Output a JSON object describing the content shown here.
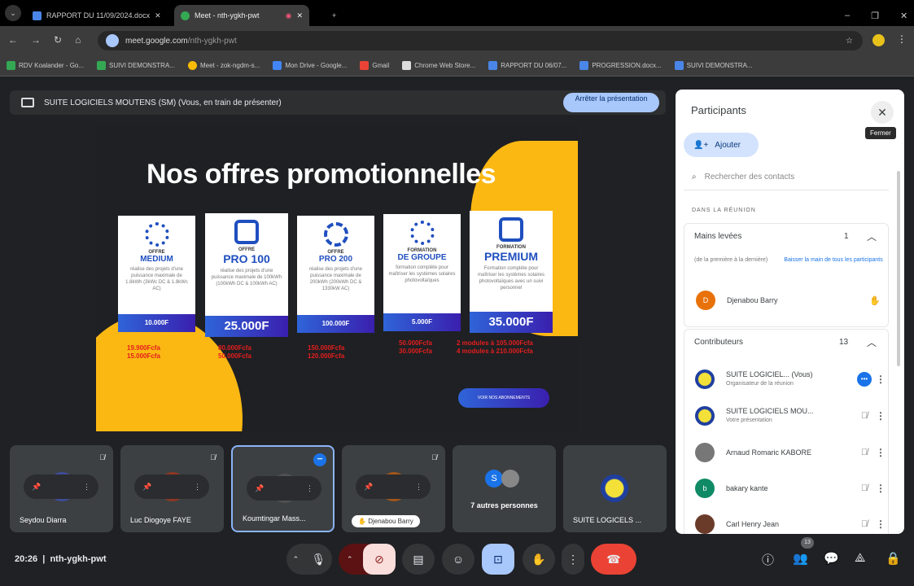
{
  "browser": {
    "tabs": [
      {
        "title": "RAPPORT DU 11/09/2024.docx"
      },
      {
        "title": "Meet - nth-ygkh-pwt"
      }
    ],
    "url_host": "meet.google.com",
    "url_path": "/nth-ygkh-pwt",
    "bookmarks": [
      "RDV Koalander - Go...",
      "SUIVI DEMONSTRA...",
      "Meet - zok-ngdm-s...",
      "Mon Drive - Google...",
      "Gmail",
      "Chrome Web Store...",
      "RAPPORT DU 06/07...",
      "PROGRESSION.docx...",
      "SUIVI DEMONSTRA..."
    ]
  },
  "banner": {
    "text": "SUITE LOGICIELS MOUTENS (SM) (Vous, en train de présenter)",
    "stop_label": "Arrêter la présentation"
  },
  "slide": {
    "title": "Nos offres promotionnelles",
    "cards": [
      {
        "kind": "OFFRE",
        "name": "MEDIUM",
        "desc": "réalise des projets d'une puissance maximale de 1.8kWh (3kWc DC & 1.8kWc AC)",
        "price": "10.000F",
        "old": [
          "19.900Fcfa",
          "15.000Fcfa"
        ]
      },
      {
        "kind": "OFFRE",
        "name": "PRO 100",
        "desc": "réalise des projets d'une puissance maximale de 100kWh (100kWh DC & 100kWh AC)",
        "price": "25.000F",
        "old": [
          "80.000Fcfa",
          "50.000Fcfa"
        ]
      },
      {
        "kind": "OFFRE",
        "name": "PRO 200",
        "desc": "réalise des projets d'une puissance maximale de 200kWh (200kWh DC & 1330kW AC)",
        "price": "100.000F",
        "old": [
          "150.000Fcfa",
          "120.000Fcfa"
        ]
      },
      {
        "kind": "FORMATION",
        "name": "DE GROUPE",
        "desc": "formation complète pour maîtriser les systèmes solaires photovoltaïques",
        "price": "5.000F",
        "old": [
          "50.000Fcfa",
          "30.000Fcfa"
        ]
      },
      {
        "kind": "FORMATION",
        "name": "PREMIUM",
        "desc": "Formation complète pour maîtriser les systèmes solaires photovoltaïques avec un suivi personnel",
        "price": "35.000F",
        "old": [
          "2 modules à 105.000Fcfa",
          "4 modules à 210.000Fcfa"
        ]
      }
    ],
    "button": "VOIR NOS ABONNEMENTS"
  },
  "panel": {
    "title": "Participants",
    "close_tooltip": "Fermer",
    "add_label": "Ajouter",
    "search_placeholder": "Rechercher des contacts",
    "section_label": "DANS LA RÉUNION",
    "hands": {
      "label": "Mains levées",
      "count": "1",
      "order": "(de la première à la dernière)",
      "lower_all": "Baisser la main de tous les participants",
      "person": {
        "initial": "D",
        "name": "Djenabou Barry"
      }
    },
    "contributors": {
      "label": "Contributeurs",
      "count": "13",
      "people": [
        {
          "name": "SUITE LOGICIEL... (Vous)",
          "sub": "Organisateur de la réunion"
        },
        {
          "name": "SUITE LOGICIELS MOU...",
          "sub": "Votre présentation"
        },
        {
          "name": "Arnaud Romaric KABORE",
          "sub": ""
        },
        {
          "initial": "b",
          "name": "bakary kante",
          "sub": ""
        },
        {
          "name": "Carl Henry Jean",
          "sub": ""
        }
      ]
    }
  },
  "tiles": [
    {
      "initial": "S",
      "name": "Seydou Diarra",
      "color": "#3f4fa8"
    },
    {
      "initial": "L",
      "name": "Luc Diogoye FAYE",
      "color": "#a0361c"
    },
    {
      "initial": "",
      "name": "Koumtingar Mass...",
      "color": "#555"
    },
    {
      "initial": "D",
      "name": "Djenabou Barry",
      "color": "#b55a12"
    },
    {
      "initial": "S",
      "name": "7 autres personnes",
      "color": "#1a73e8"
    },
    {
      "initial": "",
      "name": "SUITE LOGICELS ...",
      "color": "#1f3fa0"
    }
  ],
  "footer": {
    "time": "20:26",
    "meeting_code": "nth-ygkh-pwt",
    "participant_count": "13"
  },
  "colors": {
    "accent": "#a8c7fa",
    "end_call": "#ea4335",
    "slide_yellow": "#fbb813"
  }
}
